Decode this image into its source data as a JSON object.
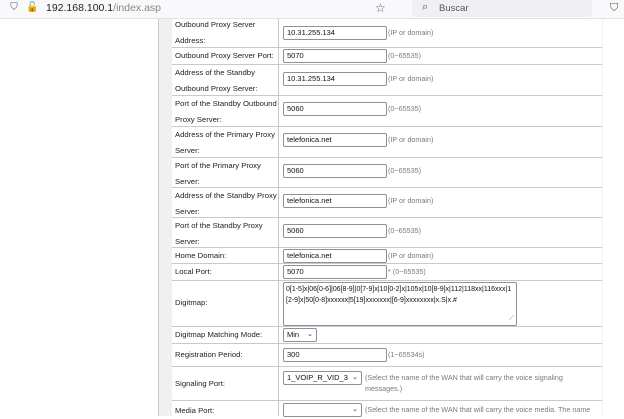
{
  "browser": {
    "url_host": "192.168.100.1",
    "url_path": "/index.asp",
    "search_placeholder": "Buscar"
  },
  "fields": {
    "outbound_proxy": {
      "label": "Outbound Proxy Server Address:",
      "value": "10.31.255.134",
      "hint": "(IP or domain)"
    },
    "outbound_port": {
      "label": "Outbound Proxy Server Port:",
      "value": "5070",
      "hint": "(0~65535)"
    },
    "standby_outbound": {
      "label": "Address of the Standby Outbound Proxy Server:",
      "value": "10.31.255.134",
      "hint": "(IP or domain)"
    },
    "standby_outbound_port": {
      "label": "Port of the Standby Outbound Proxy Server:",
      "value": "5060",
      "hint": "(0~65535)"
    },
    "primary_proxy": {
      "label": "Address of the Primary Proxy Server:",
      "value": "telefonica.net",
      "hint": "(IP or domain)"
    },
    "primary_proxy_port": {
      "label": "Port of the Primary Proxy Server:",
      "value": "5060",
      "hint": "(0~65535)"
    },
    "standby_proxy": {
      "label": "Address of the Standby Proxy Server:",
      "value": "telefonica.net",
      "hint": "(IP or domain)"
    },
    "standby_proxy_port": {
      "label": "Port of the Standby Proxy Server:",
      "value": "5060",
      "hint": "(0~65535)"
    },
    "home_domain": {
      "label": "Home Domain:",
      "value": "telefonica.net",
      "hint": "(IP or domain)"
    },
    "local_port": {
      "label": "Local Port:",
      "value": "5070",
      "hint": "* (0~65535)"
    },
    "digitmap": {
      "label": "Digitmap:",
      "value": "0[1-5]x|06[0-6]|06[8-9]|0[7-9]x|10[0-2]x|105x|10[8-9]x|112|118xx|116xxx|1[2-9]x|50[0-8]xxxxxx|5[19]xxxxxxx|[6-9]xxxxxxxx|x.S|x.#"
    },
    "digitmap_mode": {
      "label": "Digitmap Matching Mode:",
      "value": "Min"
    },
    "registration_period": {
      "label": "Registration Period:",
      "value": "300",
      "hint": "(1~65534s)"
    },
    "signaling_port": {
      "label": "Signaling Port:",
      "value": "1_VOIP_R_VID_3",
      "hint": "(Select the name of the WAN that will carry the voice signaling messages.)"
    },
    "media_port": {
      "label": "Media Port:",
      "value": "",
      "hint": "(Select the name of the WAN that will carry the voice media. The name"
    }
  }
}
